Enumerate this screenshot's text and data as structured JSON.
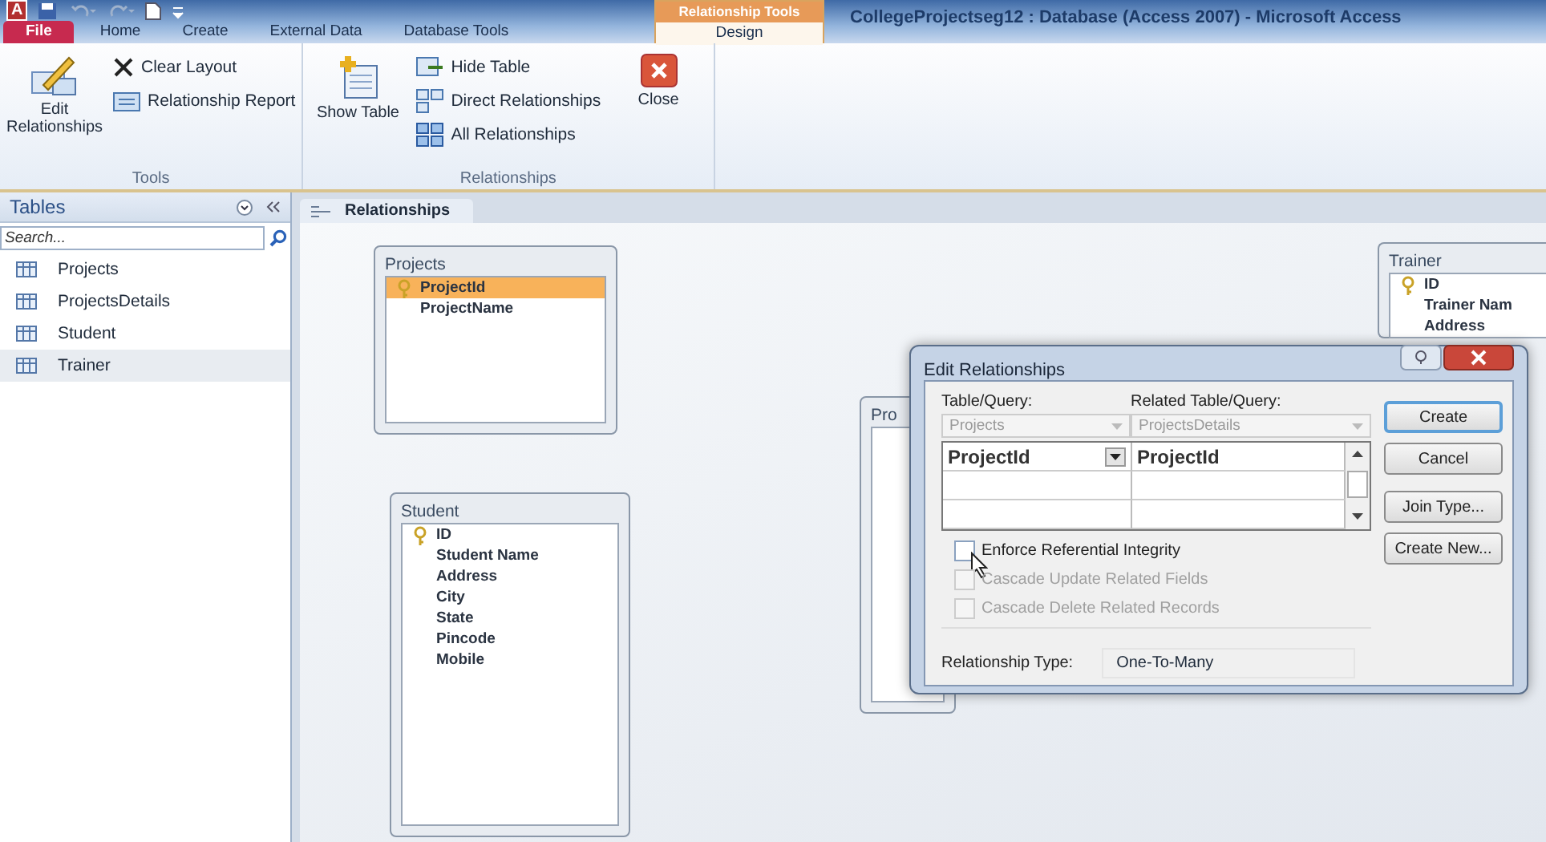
{
  "app_logo": "A",
  "context_tab": {
    "label": "Relationship Tools"
  },
  "window": {
    "title": "CollegeProjectseg12 : Database (Access 2007)  -  Microsoft Access"
  },
  "ribbon_tabs": [
    {
      "label": "File",
      "kind": "file",
      "selected": false
    },
    {
      "label": "Home",
      "kind": "tab",
      "selected": false
    },
    {
      "label": "Create",
      "kind": "tab",
      "selected": false
    },
    {
      "label": "External Data",
      "kind": "tab",
      "selected": false
    },
    {
      "label": "Database Tools",
      "kind": "tab",
      "selected": false
    },
    {
      "label": "Design",
      "kind": "context",
      "selected": true
    }
  ],
  "ribbon_groups": [
    {
      "label": "Tools",
      "commands": [
        {
          "label": "Edit Relationships",
          "kind": "large"
        },
        {
          "label": "Clear Layout",
          "kind": "small"
        },
        {
          "label": "Relationship Report",
          "kind": "small"
        }
      ]
    },
    {
      "label": "Relationships",
      "commands": [
        {
          "label": "Show Table",
          "kind": "large"
        },
        {
          "label": "Hide Table",
          "kind": "small"
        },
        {
          "label": "Direct Relationships",
          "kind": "small"
        },
        {
          "label": "All Relationships",
          "kind": "small"
        },
        {
          "label": "Close",
          "kind": "large"
        }
      ]
    }
  ],
  "nav_pane": {
    "title": "Tables",
    "search": {
      "placeholder": "Search..."
    },
    "items": [
      {
        "label": "Projects",
        "selected": false
      },
      {
        "label": "ProjectsDetails",
        "selected": false
      },
      {
        "label": "Student",
        "selected": false
      },
      {
        "label": "Trainer",
        "selected": true
      }
    ]
  },
  "document_tab": {
    "label": "Relationships"
  },
  "canvas_tables": [
    {
      "title": "Projects",
      "fields": [
        {
          "name": "ProjectId",
          "key": true,
          "selected": true
        },
        {
          "name": "ProjectName",
          "key": false,
          "selected": false
        }
      ]
    },
    {
      "title": "Student",
      "fields": [
        {
          "name": "ID",
          "key": true,
          "selected": false
        },
        {
          "name": "Student Name",
          "key": false,
          "selected": false
        },
        {
          "name": "Address",
          "key": false,
          "selected": false
        },
        {
          "name": "City",
          "key": false,
          "selected": false
        },
        {
          "name": "State",
          "key": false,
          "selected": false
        },
        {
          "name": "Pincode",
          "key": false,
          "selected": false
        },
        {
          "name": "Mobile",
          "key": false,
          "selected": false
        }
      ]
    },
    {
      "title": "Pro"
    },
    {
      "title": "Trainer",
      "fields": [
        {
          "name": "ID",
          "key": true,
          "selected": false
        },
        {
          "name": "Trainer Nam",
          "key": false,
          "selected": false
        },
        {
          "name": "Address",
          "key": false,
          "selected": false
        }
      ]
    }
  ],
  "dialog": {
    "title": "Edit Relationships",
    "table_query": {
      "label": "Table/Query:",
      "value": "Projects"
    },
    "related_query": {
      "label": "Related Table/Query:",
      "value": "ProjectsDetails"
    },
    "field_rows": [
      {
        "left": "ProjectId",
        "right": "ProjectId"
      },
      {
        "left": "",
        "right": ""
      },
      {
        "left": "",
        "right": ""
      }
    ],
    "options": [
      {
        "label": "Enforce Referential Integrity",
        "checked": false,
        "disabled": false
      },
      {
        "label": "Cascade Update Related Fields",
        "checked": false,
        "disabled": true
      },
      {
        "label": "Cascade Delete Related Records",
        "checked": false,
        "disabled": true
      }
    ],
    "relationship_type": {
      "label": "Relationship Type:",
      "value": "One-To-Many"
    },
    "buttons": [
      {
        "label": "Create",
        "default": true
      },
      {
        "label": "Cancel",
        "default": false
      },
      {
        "label": "Join Type...",
        "default": false
      },
      {
        "label": "Create New...",
        "default": false
      }
    ]
  }
}
